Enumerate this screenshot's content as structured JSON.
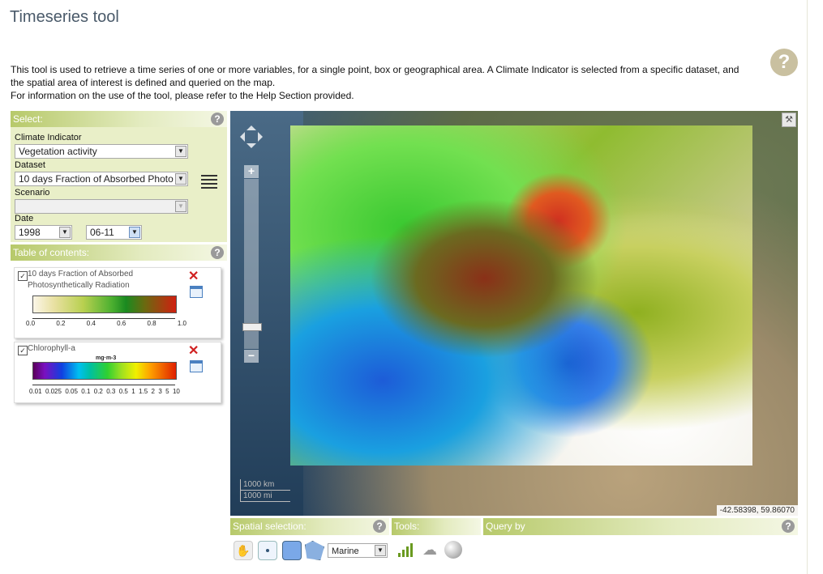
{
  "page": {
    "title": "Timeseries tool"
  },
  "intro": {
    "line1": "This tool is used to retrieve a time series of one or more variables, for a single point, box or geographical area. A Climate Indicator is selected from a specific dataset, and",
    "line2": "the spatial area of interest is defined and queried on the map.",
    "line3": "For information on the use of the tool, please refer to the Help Section provided."
  },
  "help_glyph": "?",
  "select_panel": {
    "header": "Select:",
    "climate_indicator_label": "Climate Indicator",
    "climate_indicator_value": "Vegetation activity",
    "dataset_label": "Dataset",
    "dataset_value": "10 days Fraction of Absorbed Photo",
    "scenario_label": "Scenario",
    "scenario_value": "",
    "date_label": "Date",
    "year_value": "1998",
    "day_value": "06-11"
  },
  "toc": {
    "header": "Table of contents:",
    "layers": [
      {
        "name_line1": "10 days Fraction of Absorbed",
        "name_line2": "Photosynthetically Radiation",
        "checked": true,
        "unit": "",
        "ticks": [
          "0.0",
          "0.2",
          "0.4",
          "0.6",
          "0.8",
          "1.0"
        ]
      },
      {
        "name_line1": "Chlorophyll-a",
        "name_line2": "",
        "checked": true,
        "unit": "mg·m-3",
        "ticks": [
          "0.01",
          "0.025",
          "0.05",
          "0.1",
          "0.2",
          "0.3",
          "0.5",
          "1",
          "1.5",
          "2",
          "3",
          "5",
          "10"
        ]
      }
    ]
  },
  "map": {
    "scale_top": "1000 km",
    "scale_bottom": "1000 mi",
    "coords": "-42.58398, 59.86070"
  },
  "bottom": {
    "spatial_header": "Spatial selection:",
    "tools_header": "Tools:",
    "query_header": "Query by",
    "region_select": "Marine"
  },
  "icons": [
    "pan-hand-icon",
    "point-select-icon",
    "box-select-icon",
    "polygon-select-icon",
    "chart-icon",
    "cloud-icon",
    "globe-icon"
  ]
}
